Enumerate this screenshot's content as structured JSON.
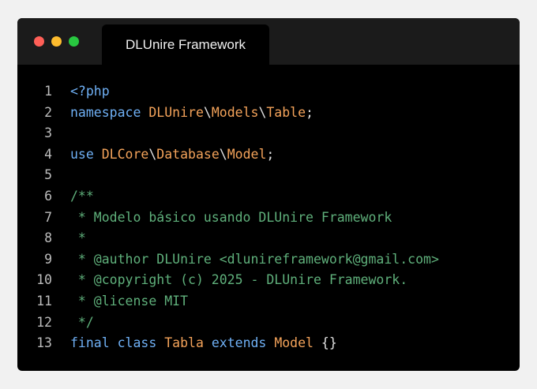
{
  "window": {
    "tab_title": "DLUnire Framework",
    "colors": {
      "close": "#ff5f57",
      "minimize": "#febc2e",
      "maximize": "#28c840"
    }
  },
  "code": {
    "lines": [
      {
        "num": "1",
        "tokens": [
          {
            "t": "<?php",
            "c": "keyword"
          }
        ]
      },
      {
        "num": "2",
        "tokens": [
          {
            "t": "namespace ",
            "c": "keyword"
          },
          {
            "t": "DLUnire",
            "c": "name"
          },
          {
            "t": "\\",
            "c": "sep"
          },
          {
            "t": "Models",
            "c": "name"
          },
          {
            "t": "\\",
            "c": "sep"
          },
          {
            "t": "Table",
            "c": "name"
          },
          {
            "t": ";",
            "c": "punct"
          }
        ]
      },
      {
        "num": "3",
        "tokens": []
      },
      {
        "num": "4",
        "tokens": [
          {
            "t": "use ",
            "c": "keyword"
          },
          {
            "t": "DLCore",
            "c": "name"
          },
          {
            "t": "\\",
            "c": "sep"
          },
          {
            "t": "Database",
            "c": "name"
          },
          {
            "t": "\\",
            "c": "sep"
          },
          {
            "t": "Model",
            "c": "name"
          },
          {
            "t": ";",
            "c": "punct"
          }
        ]
      },
      {
        "num": "5",
        "tokens": []
      },
      {
        "num": "6",
        "tokens": [
          {
            "t": "/**",
            "c": "comment"
          }
        ]
      },
      {
        "num": "7",
        "tokens": [
          {
            "t": " * Modelo básico usando DLUnire Framework",
            "c": "comment"
          }
        ]
      },
      {
        "num": "8",
        "tokens": [
          {
            "t": " *",
            "c": "comment"
          }
        ]
      },
      {
        "num": "9",
        "tokens": [
          {
            "t": " * @author DLUnire <dlunireframework@gmail.com>",
            "c": "comment"
          }
        ]
      },
      {
        "num": "10",
        "tokens": [
          {
            "t": " * @copyright (c) 2025 - DLUnire Framework.",
            "c": "comment"
          }
        ]
      },
      {
        "num": "11",
        "tokens": [
          {
            "t": " * @license MIT",
            "c": "comment"
          }
        ]
      },
      {
        "num": "12",
        "tokens": [
          {
            "t": " */",
            "c": "comment"
          }
        ]
      },
      {
        "num": "13",
        "tokens": [
          {
            "t": "final ",
            "c": "keyword"
          },
          {
            "t": "class ",
            "c": "keyword"
          },
          {
            "t": "Tabla ",
            "c": "name"
          },
          {
            "t": "extends ",
            "c": "keyword"
          },
          {
            "t": "Model ",
            "c": "name"
          },
          {
            "t": "{}",
            "c": "punct"
          }
        ]
      }
    ]
  }
}
